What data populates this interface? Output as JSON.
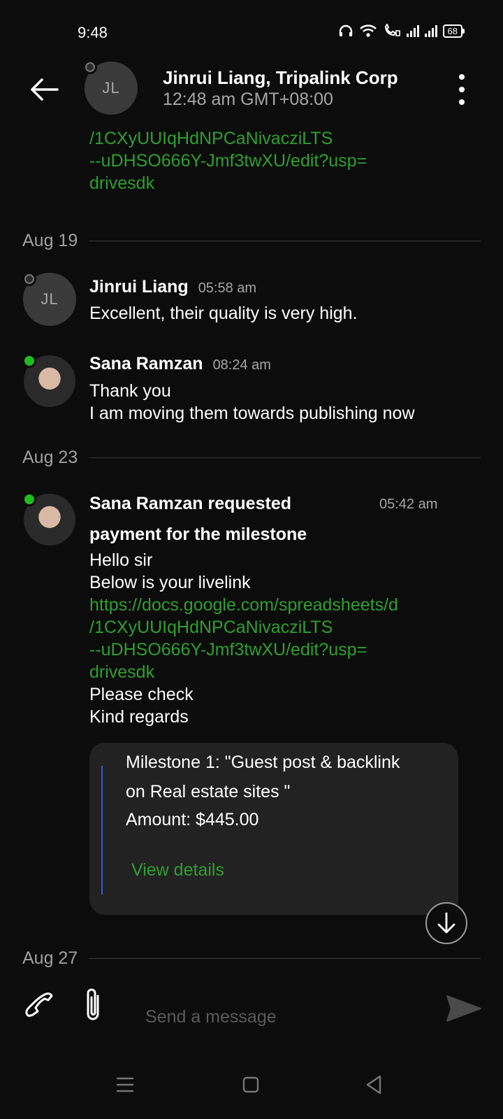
{
  "status_bar": {
    "time": "9:48",
    "battery": "68",
    "icons": [
      "headphones-icon",
      "wifi-icon",
      "wifi-calling-icon",
      "signal-1-icon",
      "signal-2-icon",
      "battery-icon"
    ]
  },
  "header": {
    "avatar_initials": "JL",
    "name": "Jinrui Liang, Tripalink Corp",
    "subtitle": "12:48 am GMT+08:00"
  },
  "top_link_fragment": [
    "/1CXyUUIqHdNPCaNivacziLTS",
    "--uDHSO666Y-Jmf3twXU/edit?usp=",
    "drivesdk"
  ],
  "groups": [
    {
      "date": "Aug 19",
      "messages": [
        {
          "avatar_initials": "JL",
          "sender": "Jinrui Liang",
          "time": "05:58 am",
          "lines": [
            "Excellent, their quality is very high."
          ]
        },
        {
          "sender": "Sana Ramzan",
          "time": "08:24 am",
          "lines": [
            "Thank you",
            "I am moving them towards publishing now"
          ]
        }
      ]
    },
    {
      "date": "Aug 23",
      "messages": [
        {
          "sender_line1": "Sana Ramzan requested",
          "sender_line2": "payment for the milestone",
          "time": "05:42 am",
          "lines_before": [
            "Hello sir",
            "Below is your livelink"
          ],
          "link_lines": [
            "https://docs.google.com/spreadsheets/d",
            "/1CXyUUIqHdNPCaNivacziLTS",
            "--uDHSO666Y-Jmf3twXU/edit?usp=",
            "drivesdk"
          ],
          "lines_after": [
            "Please check",
            "Kind regards"
          ],
          "milestone": {
            "title_line1": "Milestone 1: \"Guest post & backlink",
            "title_line2": "on Real estate sites \"",
            "amount": "Amount: $445.00",
            "action": "View details"
          }
        }
      ]
    },
    {
      "date": "Aug 27"
    }
  ],
  "composer": {
    "placeholder": "Send a message"
  },
  "colors": {
    "background": "#0c0c0c",
    "link": "#2ea02e",
    "online": "#1fbe1f",
    "card": "#222222",
    "card_accent": "#3b5bd6"
  }
}
